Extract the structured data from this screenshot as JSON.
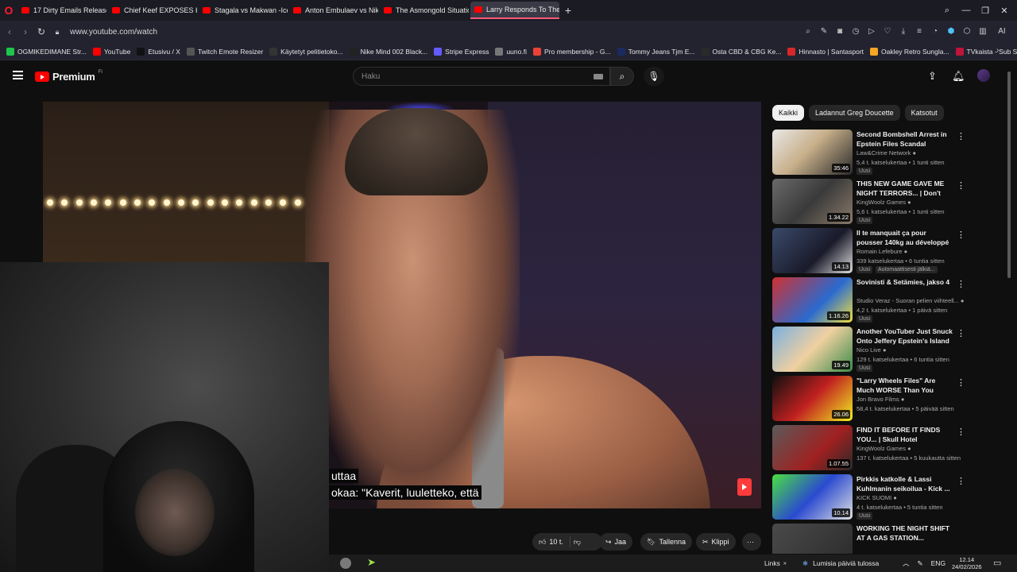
{
  "browser": {
    "tabs": [
      {
        "label": "17 Dirty Emails Released i"
      },
      {
        "label": "Chief Keef EXPOSES King"
      },
      {
        "label": "Stagala vs Makwan -Ice C"
      },
      {
        "label": "Anton Embulaev vs Nikita"
      },
      {
        "label": "The Asmongold Situation"
      },
      {
        "label": "Larry Responds To The Cu"
      }
    ],
    "url": "www.youtube.com/watch",
    "bookmarks": [
      {
        "label": "OGMIKEDIMANE Str...",
        "color": "#1ec54b"
      },
      {
        "label": "YouTube",
        "color": "#ff0000"
      },
      {
        "label": "Etusivu / X",
        "color": "#111111"
      },
      {
        "label": "Twitch Emote Resizer",
        "color": "#555555"
      },
      {
        "label": "Käytetyt pelitietoko...",
        "color": "#333333"
      },
      {
        "label": "Nike Mind 002 Black...",
        "color": "#222222"
      },
      {
        "label": "Stripe Express",
        "color": "#635bff"
      },
      {
        "label": "uuno.fi",
        "color": "#777777"
      },
      {
        "label": "Pro membership - G...",
        "color": "#ea4335"
      },
      {
        "label": "Tommy Jeans Tjm E...",
        "color": "#1b2a5e"
      },
      {
        "label": "Osta CBD & CBG Ke...",
        "color": "#2a2a2a"
      },
      {
        "label": "Hinnasto | Santasport",
        "color": "#d62828"
      },
      {
        "label": "Oakley Retro Sungla...",
        "color": "#f5a623"
      },
      {
        "label": "TVkaista - Sub Suora",
        "color": "#c0143c"
      }
    ]
  },
  "youtube": {
    "brand": "Premium",
    "country": "FI",
    "search_placeholder": "Haku"
  },
  "video": {
    "caption_line1": "uttaa",
    "caption_line2": "okaa: \"Kaverit, luuletteko, että",
    "actions": {
      "likes": "10 t.",
      "share": "Jaa",
      "save": "Tallenna",
      "clip": "Klippi"
    }
  },
  "chips": [
    "Kaikki",
    "Ladannut Greg Doucette",
    "Katsotut"
  ],
  "recommendations": [
    {
      "title": "Second Bombshell Arrest in Epstein Files Scandal",
      "channel": "Law&Crime Network",
      "meta": "5,4 t. katselukertaa • 1 tunti sitten",
      "duration": "35:46",
      "badge": "Uusi",
      "thumb": "linear-gradient(135deg,#e8e8e8 0%,#c8b08a 45%,#2a2a2a 100%)"
    },
    {
      "title": "THIS NEW GAME GAVE ME NIGHT TERRORS... | Don't Pla...",
      "channel": "KingWoolz Games",
      "meta": "5,6 t. katselukertaa • 1 tunti sitten",
      "duration": "1.34.22",
      "badge": "Uusi",
      "thumb": "linear-gradient(135deg,#6a6a6a 0%,#3a3a3a 50%,#8a7a6a 100%)"
    },
    {
      "title": "Il te manquait ça pour pousser 140kg au développé couché",
      "channel": "Romain Lefebure",
      "meta": "339 katselukertaa • 6 tuntia sitten",
      "duration": "14.13",
      "badge": "Uusi",
      "dub": "Automaattisesti jälkiä...",
      "thumb": "linear-gradient(135deg,#3a4a6a 0%,#1a1a2a 60%,#e0e0e0 100%)"
    },
    {
      "title": "Sovinisti & Setämies, jakso 4",
      "channel": "Studio Veraz - Suoran pelien viihteell...",
      "meta": "4,2 t. katselukertaa • 1 päivä sitten",
      "duration": "1.16.26",
      "badge": "Uusi",
      "thumb": "linear-gradient(135deg,#d03030 0%,#2a6ad0 60%,#f0e040 100%)"
    },
    {
      "title": "Another YouTuber Just Snuck Onto Jeffery Epstein's Island",
      "channel": "Nico Live",
      "meta": "129 t. katselukertaa • 6 tuntia sitten",
      "duration": "19.49",
      "badge": "Uusi",
      "thumb": "linear-gradient(135deg,#7ab0e0 0%,#f0d0a0 50%,#3a8a4a 100%)"
    },
    {
      "title": "\"Larry Wheels Files\" Are Much WORSE Than You EVER ...",
      "channel": "Jon Bravo Films",
      "meta": "58,4 t. katselukertaa • 5 päivää sitten",
      "duration": "26.06",
      "badge": "",
      "thumb": "linear-gradient(135deg,#101010 0%,#c02020 50%,#f0f020 100%)"
    },
    {
      "title": "FIND IT BEFORE IT FINDS YOU... | Skull Hotel",
      "channel": "KingWoolz Games",
      "meta": "137 t. katselukertaa • 5 kuukautta sitten",
      "duration": "1.07.55",
      "badge": "",
      "thumb": "linear-gradient(135deg,#5a5a5a 0%,#a02020 60%,#2a2a2a 100%)"
    },
    {
      "title": "Pirkkis katkolle & Lassi Kuhlmanin seikoilua - Kick ...",
      "channel": "KICK SUOMI",
      "meta": "4 t. katselukertaa • 5 tuntia sitten",
      "duration": "10.14",
      "badge": "Uusi",
      "thumb": "linear-gradient(135deg,#4ae040 0%,#2a4ad0 50%,#e0e0e0 100%)"
    },
    {
      "title": "WORKING THE NIGHT SHIFT AT A GAS STATION...",
      "channel": "",
      "meta": "",
      "duration": "",
      "badge": "",
      "thumb": "linear-gradient(135deg,#4a4a4a 0%,#2a2a2a 100%)"
    }
  ],
  "taskbar": {
    "links": "Links",
    "weather": "Lumisia päiviä tulossa",
    "lang": "ENG",
    "time": "12.14",
    "date": "24/02/2026"
  }
}
